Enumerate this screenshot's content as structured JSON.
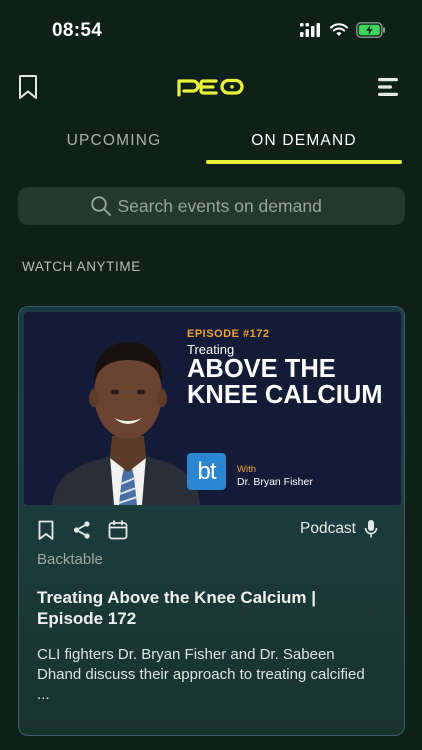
{
  "status_bar": {
    "time": "08:54",
    "icons": [
      "signal-icon",
      "wifi-icon",
      "battery-charging-icon"
    ]
  },
  "header": {
    "logo_text": "PEO",
    "left_icon": "bookmark-icon",
    "right_icon": "menu-icon",
    "accent_color": "#e8f23a"
  },
  "tabs": [
    {
      "label": "UPCOMING",
      "active": false
    },
    {
      "label": "ON DEMAND",
      "active": true
    }
  ],
  "search": {
    "placeholder": "Search events on demand",
    "value": ""
  },
  "section": {
    "label": "WATCH ANYTIME"
  },
  "card": {
    "thumbnail": {
      "episode": "EPISODE #172",
      "treating": "Treating",
      "headline": "ABOVE THE KNEE CALCIUM",
      "brand_logo": "bt",
      "with_label": "With",
      "with_name": "Dr. Bryan Fisher"
    },
    "actions": [
      "bookmark-icon",
      "share-icon",
      "calendar-icon"
    ],
    "type_label": "Podcast",
    "type_icon": "microphone-icon",
    "source": "Backtable",
    "title": "Treating Above the Knee Calcium | Episode 172",
    "description": "CLI fighters Dr. Bryan Fisher and Dr. Sabeen Dhand discuss their approach to treating calcified ..."
  }
}
